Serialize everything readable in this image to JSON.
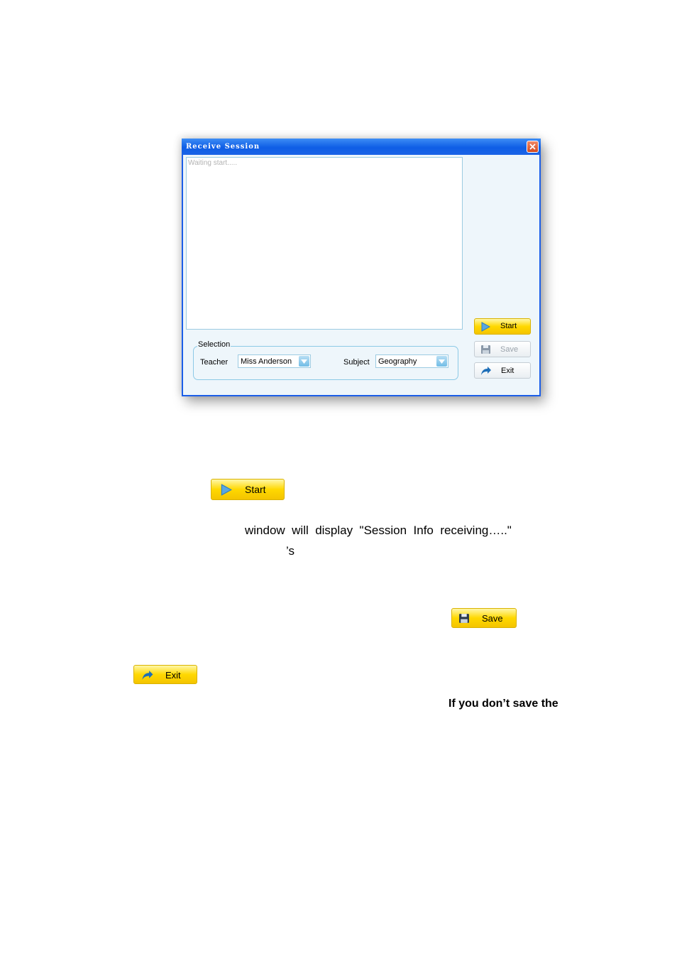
{
  "dialog": {
    "title": "Receive Session",
    "log_text": "Waiting start.....",
    "selection_label": "Selection",
    "teacher_label": "Teacher",
    "teacher_value": "Miss Anderson",
    "subject_label": "Subject",
    "subject_value": "Geography",
    "start_label": "Start",
    "save_label": "Save",
    "exit_label": "Exit",
    "save_enabled": false
  },
  "document": {
    "start_button_label": "Start",
    "line1": "window  will  display  \"Session  Info  receiving…..\"",
    "line2": "’s",
    "save_button_label": "Save",
    "exit_button_label": "Exit",
    "bold_line": "If you don’t save the"
  },
  "colors": {
    "title_bar": "#1b5ee8",
    "button_yellow": "#ffd800",
    "close_button": "#d24a1f",
    "window_background": "#eef6fb"
  },
  "icons": [
    "play-icon",
    "floppy-disk-icon",
    "exit-arrow-icon",
    "close-icon",
    "dropdown-arrow-icon"
  ]
}
